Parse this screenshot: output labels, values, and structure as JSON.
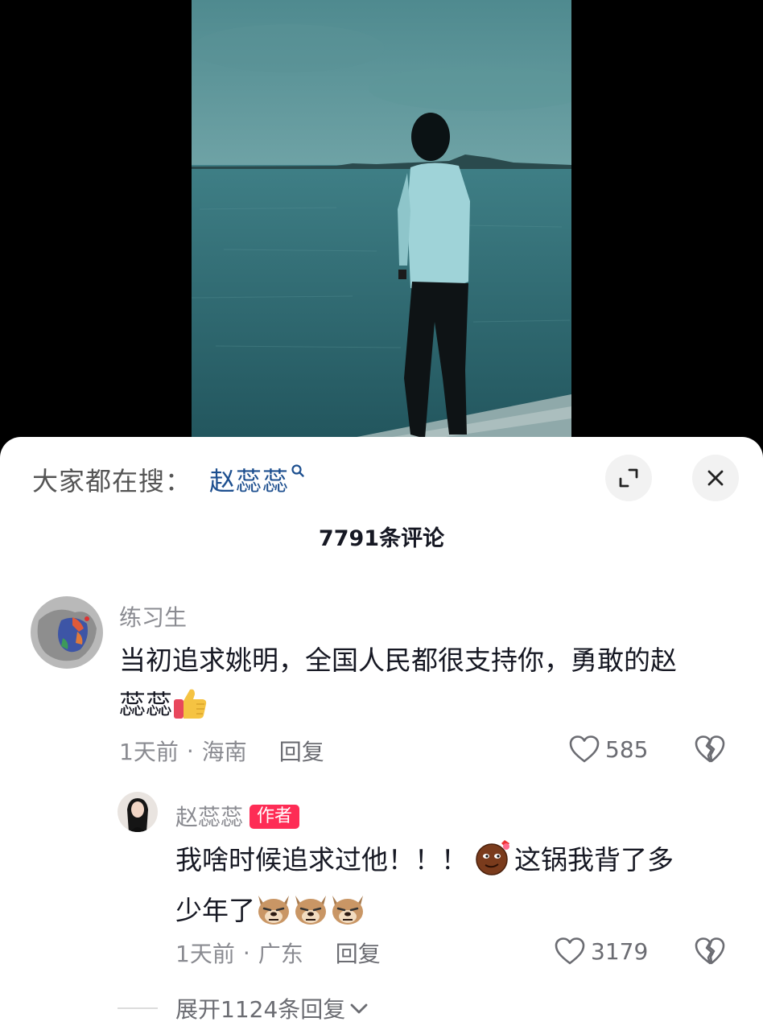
{
  "search": {
    "prefix": "大家都在搜：",
    "term": "赵蕊蕊"
  },
  "comments_header": {
    "count_label": "7791条评论"
  },
  "comment": {
    "username": "练习生",
    "text_line1": "当初追求姚明，全国人民都很支持你，勇敢的赵",
    "text_line2": "蕊蕊",
    "emoji": "thumbs-up-icon",
    "time": "1天前",
    "location": "海南",
    "reply_label": "回复",
    "likes": "585"
  },
  "reply": {
    "username": "赵蕊蕊",
    "badge": "作者",
    "text_part1": "我啥时候追求过他！！！",
    "text_part2": "这锅我背了多",
    "text_line2": "少年了",
    "time": "1天前",
    "location": "广东",
    "reply_label": "回复",
    "likes": "3179"
  },
  "expand": {
    "label": "展开1124条回复"
  },
  "colors": {
    "accent": "#fe2c55",
    "search_term": "#1d4f8f",
    "muted_text": "#8a8b91",
    "primary_text": "#161823"
  }
}
